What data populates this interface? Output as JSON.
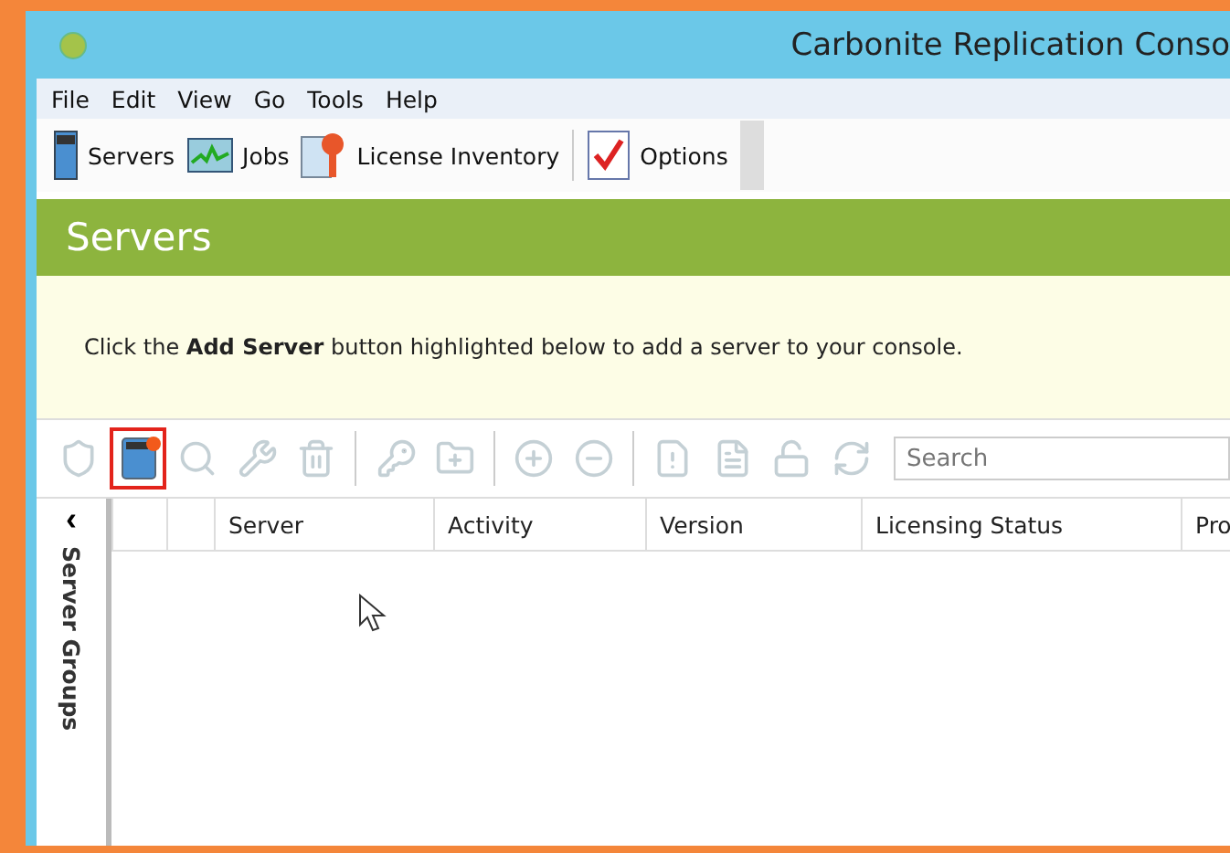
{
  "window": {
    "title": "Carbonite Replication Conso"
  },
  "menu": [
    "File",
    "Edit",
    "View",
    "Go",
    "Tools",
    "Help"
  ],
  "nav_groups": [
    [
      {
        "label": "Servers"
      },
      {
        "label": "Jobs"
      },
      {
        "label": "License Inventory"
      }
    ],
    [
      {
        "label": "Options"
      }
    ]
  ],
  "header": {
    "title": "Servers"
  },
  "notice": "Click the **Add Server** button highlighted below to add a server to your console.",
  "tool_groups": [
    [
      {
        "disabled": true,
        "highlighted": false
      },
      {
        "disabled": false,
        "highlighted": true
      },
      {
        "disabled": true,
        "highlighted": false
      },
      {
        "disabled": true,
        "highlighted": false
      },
      {
        "disabled": true,
        "highlighted": false
      }
    ],
    [
      {
        "disabled": true,
        "highlighted": false
      },
      {
        "disabled": true,
        "highlighted": false
      }
    ],
    [
      {
        "disabled": true,
        "highlighted": false
      },
      {
        "disabled": true,
        "highlighted": false
      }
    ],
    [
      {
        "disabled": true,
        "highlighted": false
      },
      {
        "disabled": true,
        "highlighted": false
      },
      {
        "disabled": true,
        "highlighted": false
      },
      {
        "disabled": true,
        "highlighted": false
      }
    ]
  ],
  "search": {
    "placeholder": "Search"
  },
  "sidebar": {
    "label": "Server Groups",
    "collapse": "‹"
  },
  "table": {
    "columns": [
      "",
      "",
      "Server",
      "Activity",
      "Version",
      "Licensing Status",
      "Pro"
    ]
  }
}
